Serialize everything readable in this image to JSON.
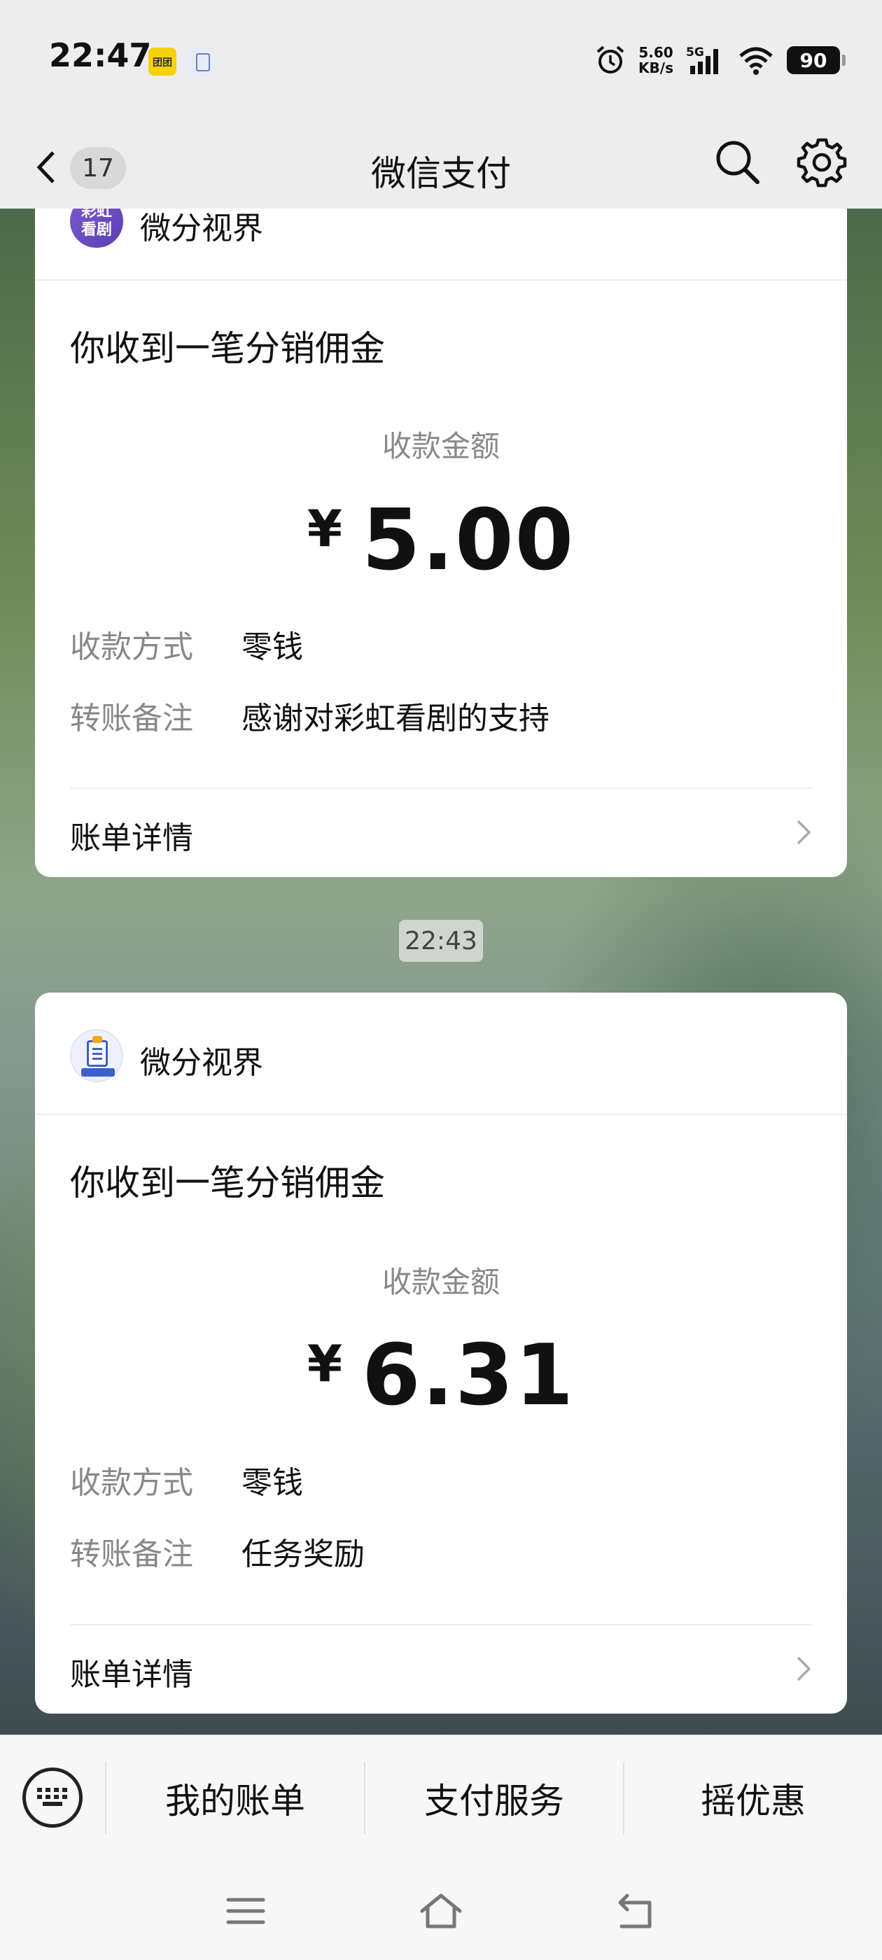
{
  "status_bar": {
    "time": "22:47",
    "notif_1_text": "团团",
    "net_speed_value": "5.60",
    "net_speed_unit": "KB/s",
    "network_type": "5G",
    "battery": "90"
  },
  "nav": {
    "back_badge": "17",
    "title": "微信支付"
  },
  "messages": [
    {
      "app_name": "微分视界",
      "avatar_text": "彩虹\n看剧",
      "title": "你收到一笔分销佣金",
      "amount_label": "收款金额",
      "currency": "¥",
      "amount": "5.00",
      "method_label": "收款方式",
      "method_value": "零钱",
      "note_label": "转账备注",
      "note_value": "感谢对彩虹看剧的支持",
      "detail_label": "账单详情"
    },
    {
      "app_name": "微分视界",
      "title": "你收到一笔分销佣金",
      "amount_label": "收款金额",
      "currency": "¥",
      "amount": "6.31",
      "method_label": "收款方式",
      "method_value": "零钱",
      "note_label": "转账备注",
      "note_value": "任务奖励",
      "detail_label": "账单详情"
    }
  ],
  "timestamp": "22:43",
  "bottom_menu": {
    "items": [
      "我的账单",
      "支付服务",
      "摇优惠"
    ]
  }
}
